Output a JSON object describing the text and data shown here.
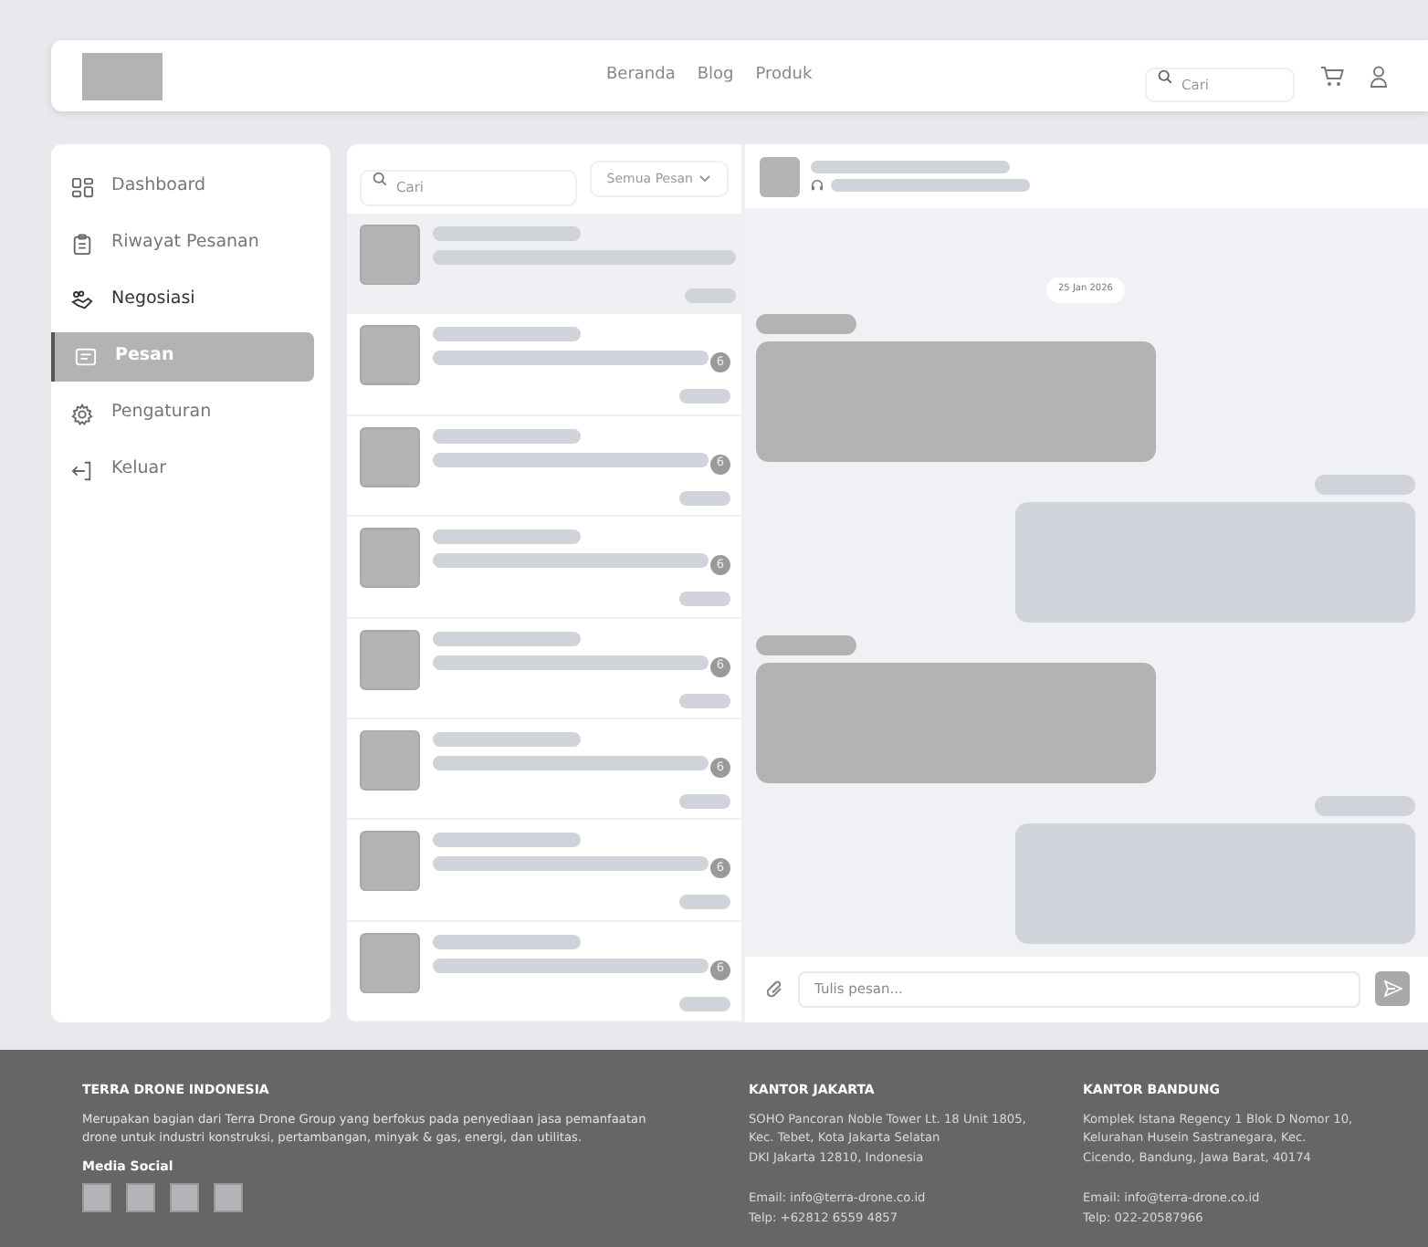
{
  "header": {
    "nav": [
      {
        "label": "Beranda"
      },
      {
        "label": "Blog"
      },
      {
        "label": "Produk"
      }
    ],
    "search": {
      "placeholder": "Cari"
    }
  },
  "sidebar": {
    "items": [
      {
        "label": "Dashboard",
        "selected": false,
        "emphasized": false
      },
      {
        "label": "Riwayat Pesanan",
        "selected": false,
        "emphasized": false
      },
      {
        "label": "Negosiasi",
        "selected": false,
        "emphasized": true
      },
      {
        "label": "Pesan",
        "selected": true,
        "emphasized": false
      },
      {
        "label": "Pengaturan",
        "selected": false,
        "emphasized": false
      },
      {
        "label": "Keluar",
        "selected": false,
        "emphasized": false
      }
    ]
  },
  "conversations": {
    "search": {
      "placeholder": "Cari"
    },
    "filter": "Semua Pesan",
    "items": [
      {
        "selected": true
      },
      {
        "selected": false,
        "badge": "6"
      },
      {
        "selected": false,
        "badge": "6"
      },
      {
        "selected": false,
        "badge": "6"
      },
      {
        "selected": false,
        "badge": "6"
      },
      {
        "selected": false,
        "badge": "6"
      },
      {
        "selected": false,
        "badge": "6"
      },
      {
        "selected": false,
        "badge": "6"
      }
    ]
  },
  "chat": {
    "date": "25 Jan 2026",
    "messages": [
      {
        "kind": "incoming"
      },
      {
        "kind": "outgoing"
      },
      {
        "kind": "incoming"
      },
      {
        "kind": "outgoing"
      }
    ],
    "composer": {
      "placeholder": "Tulis pesan..."
    }
  },
  "footer": {
    "company": {
      "title": "TERRA DRONE INDONESIA",
      "description": "Merupakan bagian dari Terra Drone Group yang berfokus pada penyediaan jasa pemanfaatan drone untuk industri konstruksi, pertambangan, minyak & gas, energi, dan utilitas.",
      "social_heading": "Media Social"
    },
    "offices": [
      {
        "title": "KANTOR JAKARTA",
        "address_lines": [
          "SOHO Pancoran Noble Tower Lt. 18 Unit 1805,",
          "Kec. Tebet, Kota Jakarta Selatan",
          "DKI Jakarta 12810, Indonesia"
        ],
        "email": "Email: info@terra-drone.co.id",
        "phone": "Telp: +62812 6559 4857"
      },
      {
        "title": "KANTOR BANDUNG",
        "address_lines": [
          "Komplek Istana Regency 1 Blok D Nomor 10,",
          "Kelurahan Husein Sastranegara, Kec.",
          "Cicendo, Bandung, Jawa Barat, 40174"
        ],
        "email": "Email: info@terra-drone.co.id",
        "phone": "Telp: 022-20587966"
      }
    ]
  }
}
